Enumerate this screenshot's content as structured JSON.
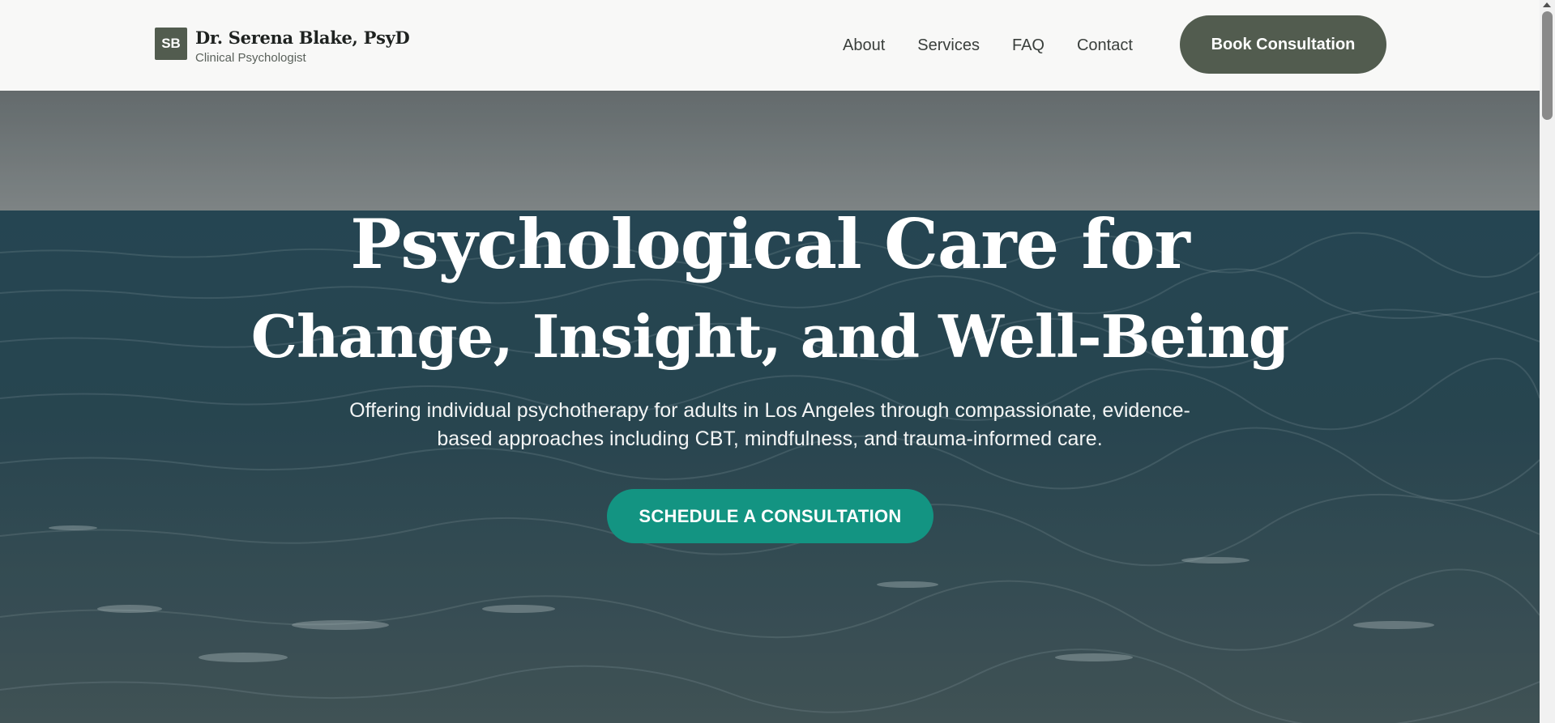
{
  "brand": {
    "badge": "SB",
    "name": "Dr. Serena Blake, PsyD",
    "subtitle": "Clinical Psychologist"
  },
  "nav": {
    "items": [
      "About",
      "Services",
      "FAQ",
      "Contact"
    ],
    "cta_label": "Book Consultation"
  },
  "hero": {
    "title_line1": "Psychological Care for",
    "title_line2": "Change, Insight, and Well-Being",
    "subtitle_line1": "Offering individual psychotherapy for adults in Los Angeles through compassionate, evidence-",
    "subtitle_line2": "based approaches including CBT, mindfulness, and trauma-informed care.",
    "cta_label": "SCHEDULE A CONSULTATION"
  },
  "colors": {
    "brand_dark": "#525c4f",
    "accent_teal": "#139482",
    "header_bg": "#f8f8f7"
  }
}
